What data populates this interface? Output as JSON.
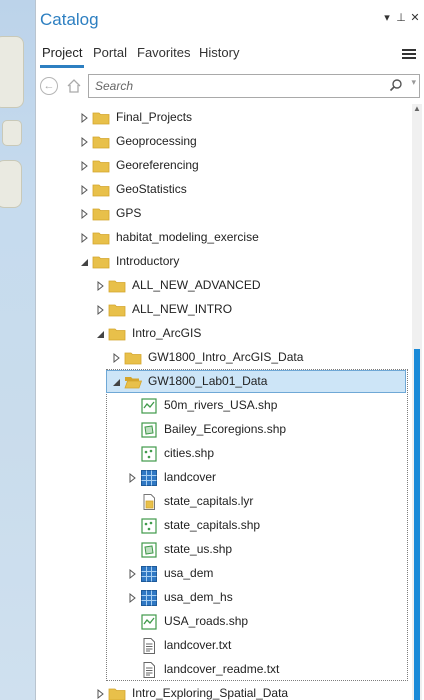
{
  "window": {
    "title": "Catalog"
  },
  "title_controls": [
    {
      "name": "dropdown-icon",
      "glyph": "▾"
    },
    {
      "name": "pin-icon",
      "glyph": "⊥"
    },
    {
      "name": "close-icon",
      "glyph": "✕"
    }
  ],
  "tabs": [
    {
      "label": "Project",
      "active": true
    },
    {
      "label": "Portal",
      "active": false
    },
    {
      "label": "Favorites",
      "active": false
    },
    {
      "label": "History",
      "active": false
    }
  ],
  "search": {
    "placeholder": "Search"
  },
  "tree": [
    {
      "depth": 0,
      "expander": "collapsed",
      "icon": "folder",
      "label": "Final_Projects"
    },
    {
      "depth": 0,
      "expander": "collapsed",
      "icon": "folder",
      "label": "Geoprocessing"
    },
    {
      "depth": 0,
      "expander": "collapsed",
      "icon": "folder",
      "label": "Georeferencing"
    },
    {
      "depth": 0,
      "expander": "collapsed",
      "icon": "folder",
      "label": "GeoStatistics"
    },
    {
      "depth": 0,
      "expander": "collapsed",
      "icon": "folder",
      "label": "GPS"
    },
    {
      "depth": 0,
      "expander": "collapsed",
      "icon": "folder",
      "label": "habitat_modeling_exercise"
    },
    {
      "depth": 0,
      "expander": "expanded",
      "icon": "folder",
      "label": "Introductory"
    },
    {
      "depth": 1,
      "expander": "collapsed",
      "icon": "folder",
      "label": "ALL_NEW_ADVANCED"
    },
    {
      "depth": 1,
      "expander": "collapsed",
      "icon": "folder",
      "label": "ALL_NEW_INTRO"
    },
    {
      "depth": 1,
      "expander": "expanded",
      "icon": "folder",
      "label": "Intro_ArcGIS"
    },
    {
      "depth": 2,
      "expander": "collapsed",
      "icon": "folder",
      "label": "GW1800_Intro_ArcGIS_Data"
    },
    {
      "depth": 2,
      "expander": "expanded",
      "icon": "folder-open",
      "label": "GW1800_Lab01_Data",
      "selected": true
    },
    {
      "depth": 3,
      "expander": "none",
      "icon": "line-shp",
      "label": "50m_rivers_USA.shp"
    },
    {
      "depth": 3,
      "expander": "none",
      "icon": "polygon-shp",
      "label": "Bailey_Ecoregions.shp"
    },
    {
      "depth": 3,
      "expander": "none",
      "icon": "point-shp",
      "label": "cities.shp"
    },
    {
      "depth": 3,
      "expander": "collapsed",
      "icon": "raster",
      "label": "landcover"
    },
    {
      "depth": 3,
      "expander": "none",
      "icon": "layer-file",
      "label": "state_capitals.lyr"
    },
    {
      "depth": 3,
      "expander": "none",
      "icon": "point-shp",
      "label": "state_capitals.shp"
    },
    {
      "depth": 3,
      "expander": "none",
      "icon": "polygon-shp",
      "label": "state_us.shp"
    },
    {
      "depth": 3,
      "expander": "collapsed",
      "icon": "raster",
      "label": "usa_dem"
    },
    {
      "depth": 3,
      "expander": "collapsed",
      "icon": "raster",
      "label": "usa_dem_hs"
    },
    {
      "depth": 3,
      "expander": "none",
      "icon": "line-shp",
      "label": "USA_roads.shp"
    },
    {
      "depth": 3,
      "expander": "none",
      "icon": "text-file",
      "label": "landcover.txt"
    },
    {
      "depth": 3,
      "expander": "none",
      "icon": "text-file",
      "label": "landcover_readme.txt"
    },
    {
      "depth": 1,
      "expander": "collapsed",
      "icon": "folder",
      "label": "Intro_Exploring_Spatial_Data"
    }
  ],
  "colors": {
    "accent": "#2d7fc1",
    "folder": "#e8c04a",
    "folder_dark": "#d4a52c",
    "selection": "#cde5f7",
    "scroll_thumb": "#1a8ad8",
    "feature_green": "#3f9a4a",
    "raster_blue": "#2f78c4"
  }
}
